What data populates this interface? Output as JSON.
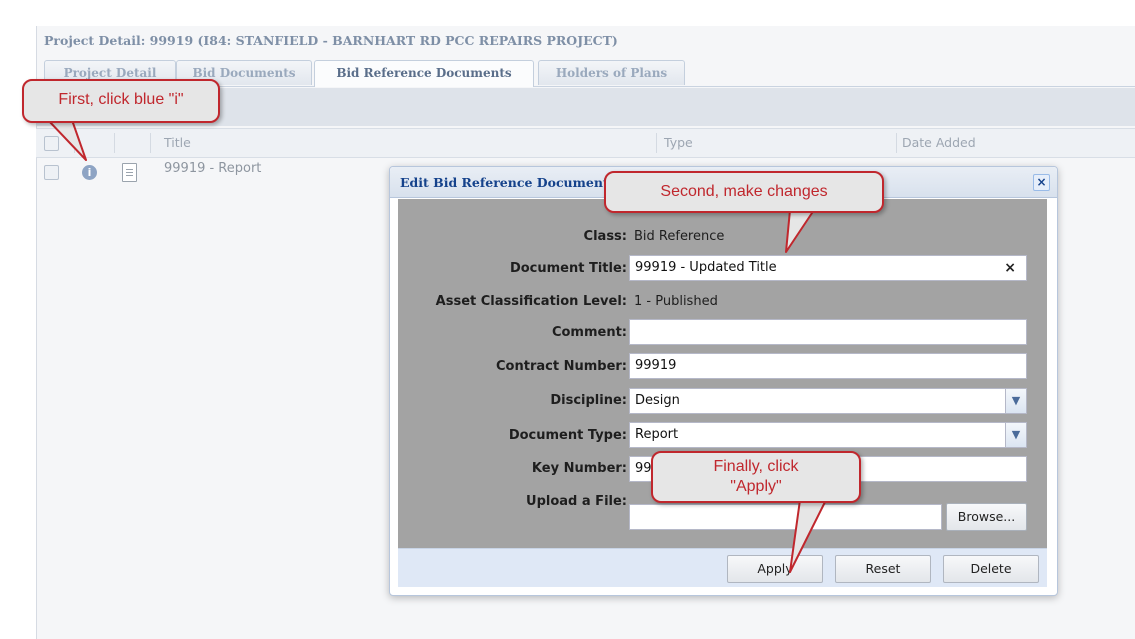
{
  "project": {
    "title": "Project Detail: 99919 (I84: STANFIELD - BARNHART RD PCC REPAIRS PROJECT)"
  },
  "tabs": [
    {
      "label": "Project Detail"
    },
    {
      "label": "Bid Documents"
    },
    {
      "label": "Bid Reference Documents",
      "active": true
    },
    {
      "label": "Holders of Plans"
    }
  ],
  "grid": {
    "columns": [
      "Title",
      "Type",
      "Date Added"
    ],
    "rows": [
      {
        "title": "99919 - Report"
      }
    ]
  },
  "dialog": {
    "title": "Edit Bid Reference Document",
    "close_icon": "×",
    "fields": {
      "class_label": "Class:",
      "class_value": "Bid Reference",
      "doc_title_label": "Document Title:",
      "doc_title_value": "99919 - Updated Title",
      "asset_label": "Asset Classification Level:",
      "asset_value": "1 - Published",
      "comment_label": "Comment:",
      "comment_value": "",
      "contract_label": "Contract Number:",
      "contract_value": "99919",
      "discipline_label": "Discipline:",
      "discipline_value": "Design",
      "doctype_label": "Document Type:",
      "doctype_value": "Report",
      "key_label": "Key Number:",
      "key_value": "99",
      "upload_label": "Upload a File:",
      "upload_value": ""
    },
    "browse_label": "Browse...",
    "buttons": {
      "apply": "Apply",
      "reset": "Reset",
      "delete": "Delete"
    }
  },
  "callouts": {
    "first": "First, click blue \"i\"",
    "second": "Second, make changes",
    "third_line1": "Finally, click",
    "third_line2": "\"Apply\""
  },
  "colors": {
    "callout_border": "#c0272d",
    "dialog_title": "#15428b",
    "info_icon": "#8ea4c4"
  }
}
